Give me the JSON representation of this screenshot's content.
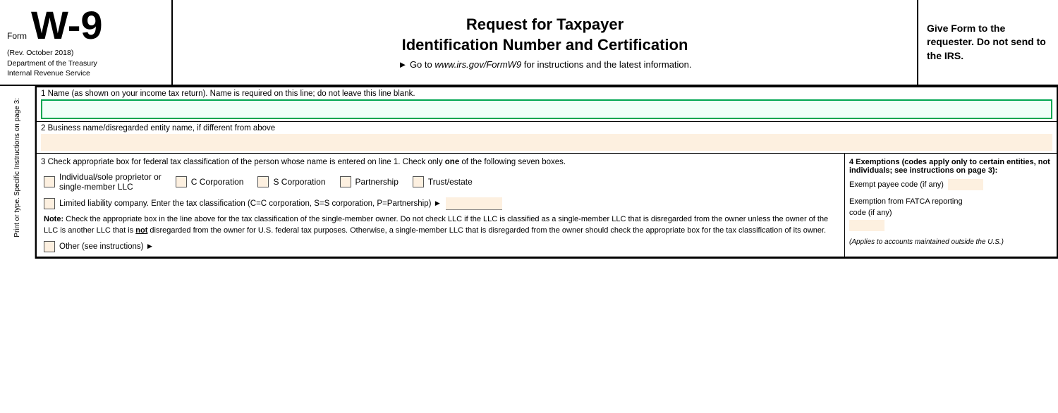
{
  "header": {
    "form_label": "Form",
    "w9": "W-9",
    "rev": "(Rev. October 2018)",
    "dept": "Department of the Treasury",
    "irs": "Internal Revenue Service",
    "main_title_line1": "Request for Taxpayer",
    "main_title_line2": "Identification Number and Certification",
    "instruction": "► Go to www.irs.gov/FormW9 for instructions and the latest information.",
    "give_form": "Give Form to the requester. Do not send to the IRS."
  },
  "side": {
    "line1": "Print or type.",
    "line2": "Specific Instructions on page 3:"
  },
  "line1": {
    "label": "1  Name (as shown on your income tax return). Name is required on this line; do not leave this line blank.",
    "value": ""
  },
  "line2": {
    "label": "2  Business name/disregarded entity name, if different from above",
    "value": ""
  },
  "line3": {
    "label_part1": "3  Check appropriate box for federal tax classification of the person whose name is entered on line 1. Check only ",
    "label_bold": "one",
    "label_part2": " of the following seven boxes.",
    "checkboxes": [
      {
        "id": "indiv",
        "label": "Individual/sole proprietor or\nsingle-member LLC"
      },
      {
        "id": "ccorp",
        "label": "C Corporation"
      },
      {
        "id": "scorp",
        "label": "S Corporation"
      },
      {
        "id": "partner",
        "label": "Partnership"
      },
      {
        "id": "trust",
        "label": "Trust/estate"
      }
    ],
    "llc_label": "Limited liability company. Enter the tax classification (C=C corporation, S=S corporation, P=Partnership) ►",
    "llc_value": "",
    "note_bold": "Note:",
    "note_text": " Check the appropriate box in the line above for the tax classification of the single-member owner.  Do not check LLC if the LLC is classified as a single-member LLC that is disregarded from the owner unless the owner of the LLC is another LLC that is ",
    "note_not": "not",
    "note_text2": " disregarded from the owner for U.S. federal tax purposes. Otherwise, a single-member LLC that is disregarded from the owner should check the appropriate box for the tax classification of its owner.",
    "other_label": "Other (see instructions) ►"
  },
  "line4": {
    "title": "4  Exemptions (codes apply only to certain entities, not individuals; see instructions on page 3):",
    "exempt_payee_label": "Exempt payee code (if any)",
    "exempt_payee_value": "",
    "fatca_label_line1": "Exemption from FATCA reporting",
    "fatca_label_line2": "code (if any)",
    "fatca_value": "",
    "applies_text": "(Applies to accounts maintained outside the U.S.)"
  }
}
